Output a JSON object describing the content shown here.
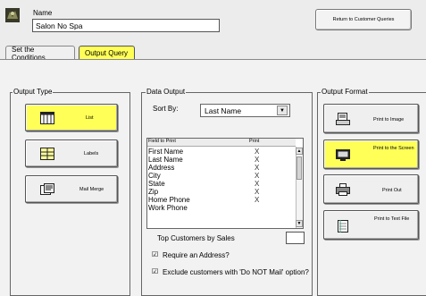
{
  "header": {
    "name_label": "Name",
    "name_value": "Salon No Spa",
    "return_button": "Return to Customer Queries"
  },
  "tabs": [
    {
      "label": "Set the Conditions",
      "active": false
    },
    {
      "label": "Output Query",
      "active": true
    }
  ],
  "output_type": {
    "title": "Output Type",
    "buttons": [
      {
        "label": "List",
        "icon": "list-icon",
        "selected": true
      },
      {
        "label": "Labels",
        "icon": "labels-icon",
        "selected": false
      },
      {
        "label": "Mail Merge",
        "icon": "mail-merge-icon",
        "selected": false
      }
    ]
  },
  "data_output": {
    "title": "Data Output",
    "sort_label": "Sort By:",
    "sort_value": "Last Name",
    "columns": [
      "Field to Print",
      "Print"
    ],
    "fields": [
      {
        "name": "First Name",
        "print": "X"
      },
      {
        "name": "Last Name",
        "print": "X"
      },
      {
        "name": "Address",
        "print": "X"
      },
      {
        "name": "City",
        "print": "X"
      },
      {
        "name": "State",
        "print": "X"
      },
      {
        "name": "Zip",
        "print": "X"
      },
      {
        "name": "Home Phone",
        "print": "X"
      },
      {
        "name": "Work Phone",
        "print": ""
      }
    ],
    "top_customers_label": "Top Customers by Sales",
    "top_customers_value": "",
    "require_address_label": "Require an Address?",
    "exclude_label": "Exclude customers with 'Do NOT Mail' option?",
    "check_mark": "☑"
  },
  "output_format": {
    "title": "Output Format",
    "buttons": [
      {
        "label": "Print to Image",
        "icon": "image-icon",
        "selected": false
      },
      {
        "label": "Print to the Screen",
        "icon": "screen-icon",
        "selected": true
      },
      {
        "label": "Print Out",
        "icon": "printer-icon",
        "selected": false
      },
      {
        "label": "Print to Text File",
        "icon": "text-file-icon",
        "selected": false
      }
    ]
  },
  "colors": {
    "selected": "#ffff57",
    "background": "#f2f2f2"
  }
}
